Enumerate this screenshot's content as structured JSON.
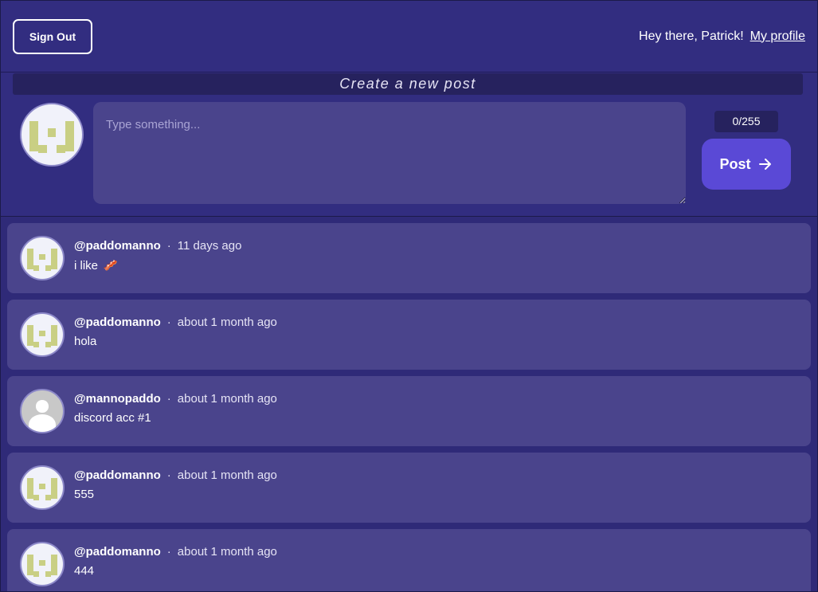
{
  "header": {
    "signout_label": "Sign Out",
    "greeting": "Hey there, Patrick!",
    "profile_link": "My profile"
  },
  "composer": {
    "title": "Create a new post",
    "placeholder": "Type something...",
    "char_count": "0/255",
    "post_label": "Post",
    "avatar_icon": "pixel-identicon-avatar"
  },
  "feed": {
    "separator": "·",
    "posts": [
      {
        "username": "@paddomanno",
        "time": "11 days ago",
        "text": "i like",
        "emoji": "🥓",
        "avatar": "pixel-identicon-avatar"
      },
      {
        "username": "@paddomanno",
        "time": "about 1 month ago",
        "text": "hola",
        "avatar": "pixel-identicon-avatar"
      },
      {
        "username": "@mannopaddo",
        "time": "about 1 month ago",
        "text": "discord acc #1",
        "avatar": "default-user-avatar"
      },
      {
        "username": "@paddomanno",
        "time": "about 1 month ago",
        "text": "555",
        "avatar": "pixel-identicon-avatar"
      },
      {
        "username": "@paddomanno",
        "time": "about 1 month ago",
        "text": "444",
        "avatar": "pixel-identicon-avatar"
      }
    ]
  },
  "colors": {
    "background": "#2f2a78",
    "card": "#4a448c",
    "accent": "#5a49d6",
    "identicon": "#c9cf84"
  }
}
